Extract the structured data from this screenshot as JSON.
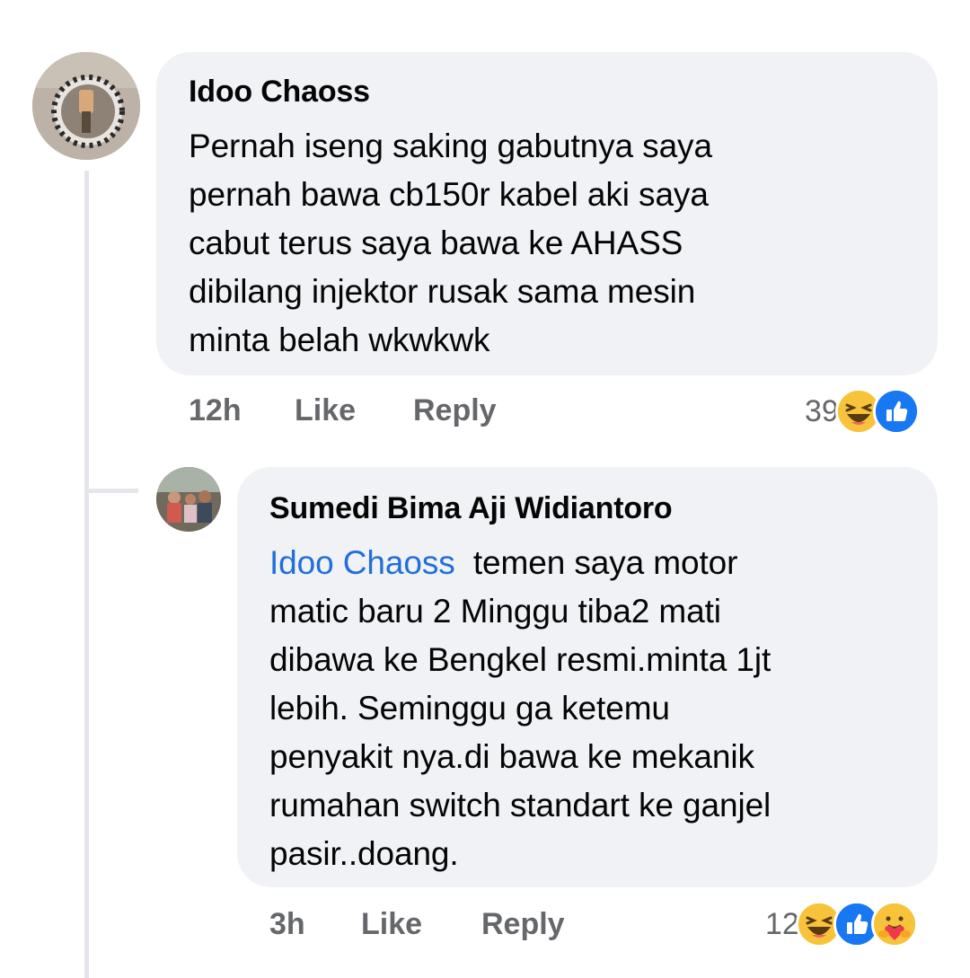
{
  "comments": [
    {
      "author": "Idoo Chaoss",
      "text": "Pernah iseng saking gabutnya saya pernah bawa cb150r kabel aki saya cabut terus saya bawa ke AHASS dibilang injektor rusak sama mesin minta belah wkwkwk",
      "lines": [
        "Pernah iseng saking gabutnya saya",
        "pernah bawa cb150r kabel aki saya",
        "cabut terus saya bawa ke AHASS",
        "dibilang injektor rusak sama mesin",
        "minta belah wkwkwk"
      ],
      "time": "12h",
      "like_label": "Like",
      "reply_label": "Reply",
      "reaction_count": "39",
      "reactions": [
        "haha-icon",
        "like-icon"
      ]
    },
    {
      "author": "Sumedi Bima Aji Widiantoro",
      "mention": "Idoo Chaoss",
      "first_line_rest": "temen saya motor",
      "lines": [
        "matic baru 2 Minggu tiba2 mati",
        "dibawa ke Bengkel resmi.minta 1jt",
        "lebih. Seminggu ga ketemu",
        "penyakit nya.di bawa ke mekanik",
        "rumahan switch standart ke ganjel",
        "pasir..doang."
      ],
      "time": "3h",
      "like_label": "Like",
      "reply_label": "Reply",
      "reaction_count": "12",
      "reactions": [
        "haha-icon",
        "like-icon",
        "care-icon"
      ]
    }
  ],
  "colors": {
    "bubble": "#f0f2f5",
    "mention": "#216fdb",
    "meta": "#65676b",
    "like_blue": "#1877f2",
    "haha_yellow": "#f7c33b"
  }
}
